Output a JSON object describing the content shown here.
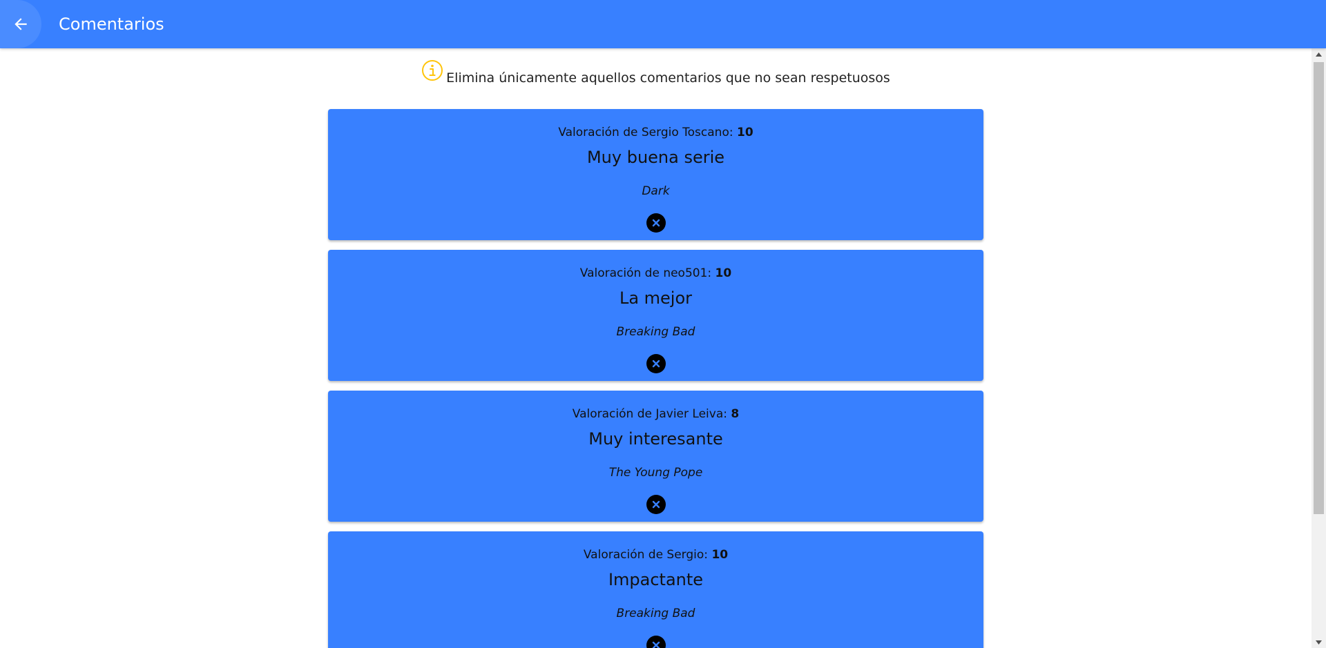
{
  "toolbar": {
    "title": "Comentarios",
    "back_icon": "arrow-back-icon",
    "color": "#3880ff"
  },
  "notice": {
    "icon": "info-icon",
    "icon_color": "#ffc409",
    "text": "Elimina únicamente aquellos comentarios que no sean respetuosos"
  },
  "comments": [
    {
      "rating_prefix": "Valoración de Sergio Toscano: ",
      "rating_value": "10",
      "title": "Muy buena serie",
      "series": "Dark",
      "delete_icon": "close-circle-icon"
    },
    {
      "rating_prefix": "Valoración de neo501: ",
      "rating_value": "10",
      "title": "La mejor",
      "series": "Breaking Bad",
      "delete_icon": "close-circle-icon"
    },
    {
      "rating_prefix": "Valoración de Javier Leiva: ",
      "rating_value": "8",
      "title": "Muy interesante",
      "series": "The Young Pope",
      "delete_icon": "close-circle-icon"
    },
    {
      "rating_prefix": "Valoración de Sergio: ",
      "rating_value": "10",
      "title": "Impactante",
      "series": "Breaking Bad",
      "delete_icon": "close-circle-icon"
    }
  ],
  "card_color": "#3880ff"
}
